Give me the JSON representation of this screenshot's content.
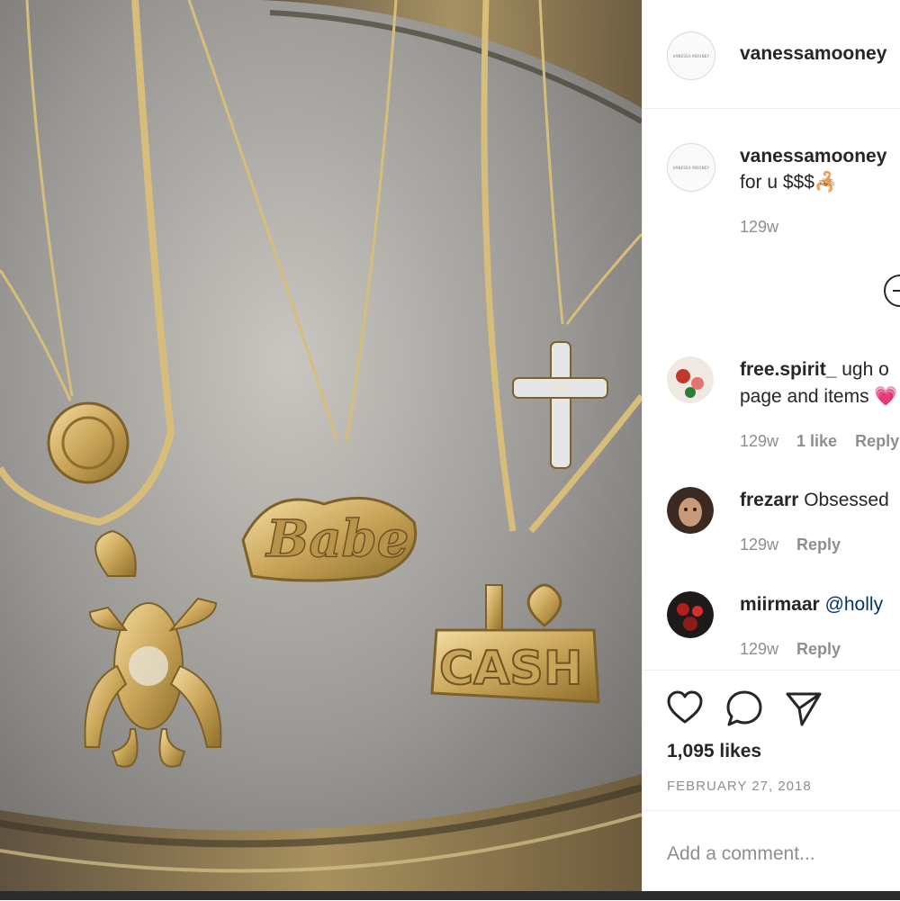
{
  "post": {
    "username": "vanessamooney",
    "avatar_text": "VANESSA MOONEY",
    "caption": {
      "username": "vanessamooney",
      "text": "for u $$$🦂",
      "time": "129w"
    },
    "comments": [
      {
        "user": "free.spirit_",
        "text": " ugh o",
        "text2": "page and items 💗",
        "time": "129w",
        "likes": "1 like",
        "reply": "Reply"
      },
      {
        "user": "frezarr",
        "text": " Obsessed",
        "time": "129w",
        "reply": "Reply"
      },
      {
        "user": "miirmaar",
        "text": " ",
        "mention": "@holly",
        "time": "129w",
        "reply": "Reply"
      }
    ],
    "likes": "1,095 likes",
    "date": "FEBRUARY 27, 2018",
    "comment_placeholder": "Add a comment..."
  },
  "icons": {
    "like": "heart-icon",
    "comment": "comment-icon",
    "share": "send-icon",
    "load_more": "plus-circle-icon"
  },
  "colors": {
    "text": "#262626",
    "secondary": "#8e8e8e",
    "link": "#00376b",
    "border": "#efefef"
  }
}
